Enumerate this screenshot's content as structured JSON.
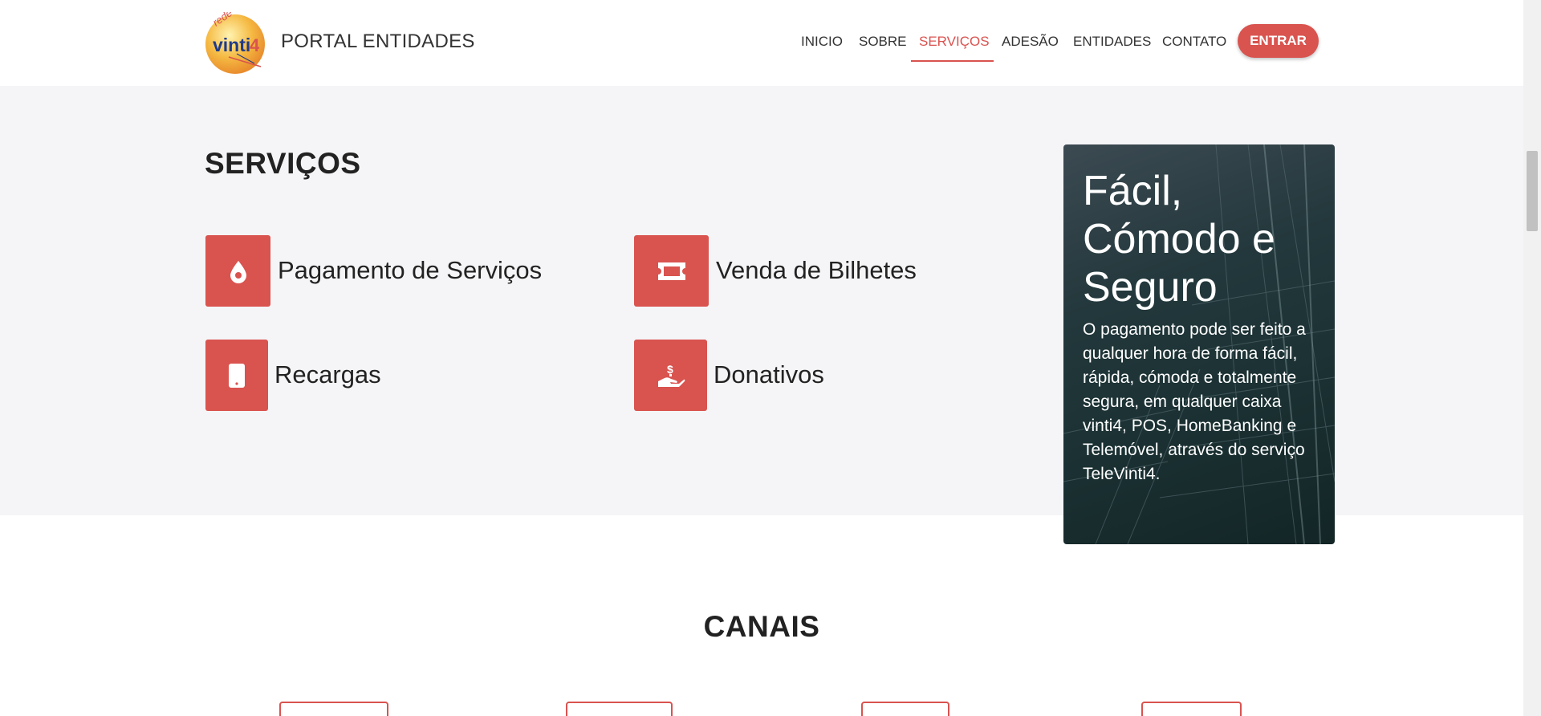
{
  "header": {
    "brand": "PORTAL ENTIDADES",
    "logo_text": "rede vinti4",
    "nav": [
      {
        "label": "INICIO",
        "active": false
      },
      {
        "label": "SOBRE",
        "active": false
      },
      {
        "label": "SERVIÇOS",
        "active": true
      },
      {
        "label": "ADESÃO",
        "active": false
      },
      {
        "label": "ENTIDADES",
        "active": false
      },
      {
        "label": "CONTATO",
        "active": false
      }
    ],
    "login_button": "ENTRAR"
  },
  "servicos": {
    "title": "SERVIÇOS",
    "items": [
      {
        "label": "Pagamento de Serviços",
        "icon": "drop-icon"
      },
      {
        "label": "Venda de Bilhetes",
        "icon": "ticket-icon"
      },
      {
        "label": "Recargas",
        "icon": "mobile-phone-icon"
      },
      {
        "label": "Donativos",
        "icon": "hand-coin-icon"
      }
    ]
  },
  "promo": {
    "title": "Fácil, Cómodo e Seguro",
    "text": "O pagamento pode ser feito a qualquer hora de forma fácil, rápida, cómoda e totalmente segura, em qualquer caixa vinti4, POS, HomeBanking e Telemóvel, através do serviço TeleVinti4."
  },
  "canais": {
    "title": "CANAIS"
  },
  "colors": {
    "accent": "#d9534f",
    "section_bg": "#f5f5f7"
  }
}
